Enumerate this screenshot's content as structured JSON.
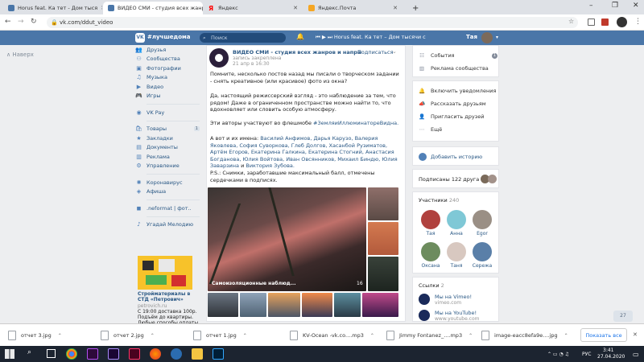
{
  "browser": {
    "tabs": [
      {
        "title": "Horus feat. Ка тет - Дом тыся",
        "active": false,
        "color": "#4a76a8"
      },
      {
        "title": "ВИДЕО СМИ - студия всех жанр",
        "active": true,
        "color": "#4a76a8"
      },
      {
        "title": "Яндекс",
        "active": false,
        "color": "#ff0000"
      },
      {
        "title": "Яндекс.Почта",
        "active": false,
        "color": "#f5a623"
      }
    ],
    "new_tab": "+",
    "url": "vk.com/ddut_video",
    "controls": {
      "minimize": "–",
      "maximize": "❐",
      "close": "✕"
    }
  },
  "vk_header": {
    "logo": "VK",
    "tagline": "#лучшедома",
    "search_placeholder": "Поиск",
    "player_text": "Horus feat. Ка тет – Дом тысячи с",
    "user_name": "Тая"
  },
  "back_link": "Наверх",
  "left_nav": {
    "group1": [
      {
        "label": "Друзья",
        "icon": "friends-icon"
      },
      {
        "label": "Сообщества",
        "icon": "communities-icon"
      },
      {
        "label": "Фотографии",
        "icon": "photos-icon"
      },
      {
        "label": "Музыка",
        "icon": "music-icon"
      },
      {
        "label": "Видео",
        "icon": "video-icon"
      },
      {
        "label": "Игры",
        "icon": "games-icon"
      }
    ],
    "group2": [
      {
        "label": "VK Pay",
        "icon": "vkpay-icon"
      }
    ],
    "group3": [
      {
        "label": "Товары",
        "icon": "goods-icon",
        "count": "1"
      },
      {
        "label": "Закладки",
        "icon": "bookmarks-icon"
      },
      {
        "label": "Документы",
        "icon": "documents-icon"
      },
      {
        "label": "Реклама",
        "icon": "ads-icon"
      },
      {
        "label": "Управление",
        "icon": "manage-icon"
      }
    ],
    "group4": [
      {
        "label": "Коронавирус",
        "icon": "corona-icon"
      },
      {
        "label": "Афиша",
        "icon": "afisha-icon"
      }
    ],
    "group5": [
      {
        "label": ".neformat | фот..",
        "icon": "app-icon"
      }
    ],
    "group6": [
      {
        "label": "Угадай Мелодию",
        "icon": "game-icon"
      }
    ],
    "ad": {
      "title": "Стройматериалы в СТД «Петрович»",
      "domain": "petrovich.ru",
      "lines": [
        "С 19:00 доставка 100р.",
        "Подъём до квартиры.",
        "Любые способы оплаты"
      ]
    }
  },
  "post": {
    "author": "ВИДЕО СМИ - студия всех жанров и направле...",
    "subtitle": "запись закреплена",
    "date": "21 апр в 16:30",
    "follow": "Подписаться",
    "p1": "Помните, несколько постов назад мы писали о творческом задании - снять креативное (или красивое) фото из окна?",
    "p2": "Да, настоящий режиссерский взгляд - это наблюдение за тем, что рядом! Даже в ограниченном пространстве можно найти то, что вдохновляет или словить особую атмосферу.",
    "p3_text": "Эти авторы участвуют во флешмобе ",
    "p3_tag": "#ЗемляиИллюминатореВидна.",
    "p4_text": "А вот и их имена: ",
    "p4_names": "Василий Анфимов, Дарья Карузо, Валерия Яковлева, София Суворкова, Глеб Долгов, Хасанбой Рузиматов, Артём Егоров, Екатерина Галкина, Екатерина Стогний, Анастасия Богданова, Юлия Войтова, Иван Овсянников, Михаил Биндю, Юлия Заварзина",
    "p4_and": " и ",
    "p4_last": "Виктория Зубова.",
    "p5": "P.S.: Снимки, заработавшие максимальный балл, отмечены сердечками в подписях.",
    "album_caption": "Самоизоляционные наблюд...",
    "album_count": "16"
  },
  "right": {
    "menu1": [
      {
        "label": "События",
        "icon": "events-icon",
        "count": "1"
      },
      {
        "label": "Реклама сообщества",
        "icon": "ads-chart-icon"
      }
    ],
    "menu2": [
      {
        "label": "Включить уведомления",
        "icon": "bell-icon"
      },
      {
        "label": "Рассказать друзьям",
        "icon": "share-icon"
      },
      {
        "label": "Пригласить друзей",
        "icon": "invite-icon"
      },
      {
        "label": "Ещё",
        "icon": "more-icon"
      }
    ],
    "add_story": "Добавить историю",
    "friends_subscribed": "Подписаны 122 друга",
    "members_title": "Участники",
    "members_count": "240",
    "members": [
      {
        "name": "Тая",
        "color": "#b0413e"
      },
      {
        "name": "Анна",
        "color": "#7fc8d6"
      },
      {
        "name": "Egor",
        "color": "#9a8f85"
      },
      {
        "name": "Оксана",
        "color": "#6d8c5e"
      },
      {
        "name": "Таня",
        "color": "#d8c8c0"
      },
      {
        "name": "Сережа",
        "color": "#5a7fa8"
      }
    ],
    "links_title": "Ссылки",
    "links_count": "2",
    "links": [
      {
        "title": "Мы на Vimeo!",
        "url": "vimeo.com"
      },
      {
        "title": "Мы на YouTube!",
        "url": "www.youtube.com"
      }
    ],
    "chat_badge": "27"
  },
  "downloads": {
    "files": [
      {
        "name": "отчет 3.jpg"
      },
      {
        "name": "отчет 2.jpg"
      },
      {
        "name": "отчет 1.jpg"
      },
      {
        "name": "KV-Ocean -vk.co....mp3"
      },
      {
        "name": "Jimmy Fontanez_....mp3"
      },
      {
        "name": "image-eacc8efa9e....jpg"
      }
    ],
    "show_all": "Показать все",
    "close": "✕"
  },
  "taskbar": {
    "lang": "РУС",
    "time": "3:41",
    "date": "27.04.2020"
  },
  "colors": {
    "vk_blue": "#4a76a8",
    "link": "#2a5885",
    "bg": "#edeef0"
  }
}
